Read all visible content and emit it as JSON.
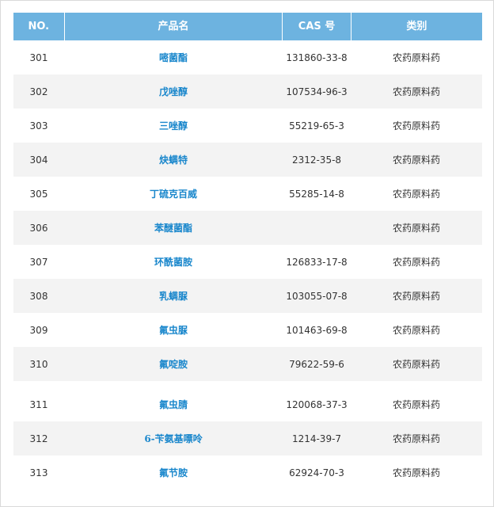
{
  "table": {
    "headers": [
      "NO.",
      "产品名",
      "CAS 号",
      "类别"
    ],
    "rows": [
      {
        "no": "301",
        "name": "嘧菌酯",
        "cas": "131860-33-8",
        "category": "农药原料药"
      },
      {
        "no": "302",
        "name": "戊唑醇",
        "cas": "107534-96-3",
        "category": "农药原料药"
      },
      {
        "no": "303",
        "name": "三唑醇",
        "cas": "55219-65-3",
        "category": "农药原料药"
      },
      {
        "no": "304",
        "name": "炔螨特",
        "cas": "2312-35-8",
        "category": "农药原料药"
      },
      {
        "no": "305",
        "name": "丁硫克百威",
        "cas": "55285-14-8",
        "category": "农药原料药"
      },
      {
        "no": "306",
        "name": "苯醚菌酯",
        "cas": "",
        "category": "农药原料药"
      },
      {
        "no": "307",
        "name": "环酰菌胺",
        "cas": "126833-17-8",
        "category": "农药原料药"
      },
      {
        "no": "308",
        "name": "乳螨脲",
        "cas": "103055-07-8",
        "category": "农药原料药"
      },
      {
        "no": "309",
        "name": "氟虫脲",
        "cas": "101463-69-8",
        "category": "农药原料药"
      },
      {
        "no": "310",
        "name": "氟啶胺",
        "cas": "79622-59-6",
        "category": "农药原料药"
      },
      {
        "no": "311",
        "name": "氟虫腈",
        "cas": "120068-37-3",
        "category": "农药原料药"
      },
      {
        "no": "312",
        "name": "6-苄氨基嘌呤",
        "cas": "1214-39-7",
        "category": "农药原料药"
      },
      {
        "no": "313",
        "name": "氟节胺",
        "cas": "62924-70-3",
        "category": "农药原料药"
      }
    ]
  },
  "colors": {
    "header_bg": "#6db3e0",
    "link": "#1a87cc",
    "alt_row": "#f3f3f3"
  }
}
